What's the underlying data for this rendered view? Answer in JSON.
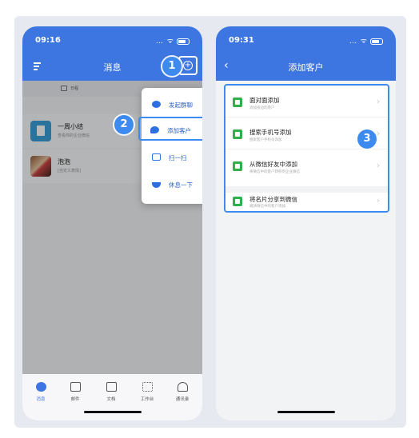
{
  "left_phone": {
    "status_time": "09:16",
    "status_icons": "… ᯤ",
    "nav_title": "消息",
    "date_label": "日程",
    "messages": [
      {
        "title": "一周小结",
        "subtitle": "查看你的企业微信"
      },
      {
        "title": "泡泡",
        "subtitle": "[自定义表情]"
      }
    ],
    "popup": {
      "items": [
        {
          "label": "发起群聊",
          "icon": "chat-bubble-icon"
        },
        {
          "label": "添加客户",
          "icon": "wechat-icon"
        },
        {
          "label": "扫一扫",
          "icon": "scan-icon"
        },
        {
          "label": "休息一下",
          "icon": "coffee-icon"
        }
      ]
    },
    "tabs": [
      {
        "label": "消息",
        "icon": "chat-icon",
        "active": true
      },
      {
        "label": "邮件",
        "icon": "mail-icon",
        "active": false
      },
      {
        "label": "文档",
        "icon": "docs-icon",
        "active": false
      },
      {
        "label": "工作台",
        "icon": "grid-icon",
        "active": false
      },
      {
        "label": "通讯录",
        "icon": "contacts-icon",
        "active": false
      }
    ]
  },
  "right_phone": {
    "status_time": "09:31",
    "status_icons": "… ᯤ",
    "nav_title": "添加客户",
    "rows": [
      {
        "title": "面对面添加",
        "subtitle": "添加身边的客户"
      },
      {
        "title": "搜索手机号添加",
        "subtitle": "搜索客户手机号添加"
      },
      {
        "title": "从微信好友中添加",
        "subtitle": "将微信中的客户转移到企业微信"
      },
      {
        "title": "将名片分享到微信",
        "subtitle": "邀请微信中的客户添加"
      }
    ]
  },
  "badges": [
    "1",
    "2",
    "3"
  ],
  "colors": {
    "brand_blue": "#3d76e1",
    "highlight_blue": "#3d8bf0",
    "green_icon": "#2bb24c"
  }
}
